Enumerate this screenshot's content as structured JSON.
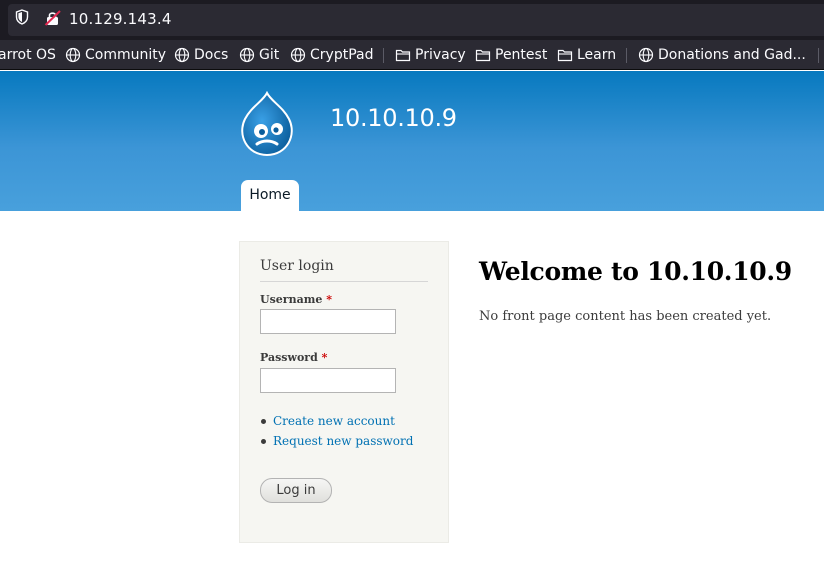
{
  "browser": {
    "url": "10.129.143.4",
    "bookmarks": [
      {
        "label": "arrot OS",
        "icon": "none"
      },
      {
        "label": "Community",
        "icon": "globe-icon"
      },
      {
        "label": "Docs",
        "icon": "globe-icon"
      },
      {
        "label": "Git",
        "icon": "globe-icon"
      },
      {
        "label": "CryptPad",
        "icon": "globe-icon"
      },
      {
        "label": "Privacy",
        "icon": "folder-icon"
      },
      {
        "label": "Pentest",
        "icon": "folder-icon"
      },
      {
        "label": "Learn",
        "icon": "folder-icon"
      },
      {
        "label": "Donations and Gad...",
        "icon": "globe-icon"
      }
    ]
  },
  "site": {
    "name": "10.10.10.9",
    "logo_icon": "drupal-drop-logo",
    "nav": {
      "home_label": "Home"
    },
    "colors": {
      "header_top": "#0779bf",
      "header_bottom": "#48a0dc",
      "link": "#0071b3",
      "required": "#cc0000"
    }
  },
  "login": {
    "title": "User login",
    "username_label": "Username",
    "password_label": "Password",
    "required_marker": "*",
    "username_value": "",
    "password_value": "",
    "links": [
      "Create new account",
      "Request new password"
    ],
    "submit_label": "Log in"
  },
  "main": {
    "title": "Welcome to 10.10.10.9",
    "message": "No front page content has been created yet."
  }
}
